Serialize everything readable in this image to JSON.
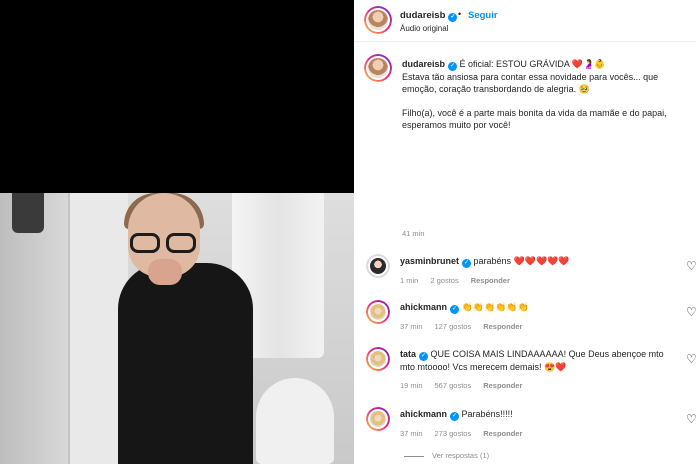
{
  "post": {
    "username": "dudareisb",
    "follow_label": "Seguir",
    "audio_label": "Áudio original",
    "caption_line1": "É oficial: ESTOU GRÁVIDA ❤️🤰👶",
    "caption_line2": "Estava tão ansiosa para contar essa novidade para vocês... que emoção, coração transbordando de alegria. 🥹",
    "caption_line3": "Filho(a), você é a parte mais bonita da vida da mamãe e do papai, esperamos muito por você!",
    "time": "41 min"
  },
  "comments": [
    {
      "user": "yasminbrunet",
      "verified": true,
      "text": "parabéns ❤️❤️❤️❤️❤️",
      "time": "1 min",
      "likes": "2 gostos",
      "reply": "Responder"
    },
    {
      "user": "ahickmann",
      "verified": true,
      "text": "👏👏👏👏👏👏",
      "time": "37 min",
      "likes": "127 gostos",
      "reply": "Responder"
    },
    {
      "user": "tata",
      "verified": true,
      "text": "QUE COISA MAIS LINDAAAAAA! Que Deus abençoe mto mto mtoooo! Vcs merecem demais! 😍❤️",
      "time": "19 min",
      "likes": "567 gostos",
      "reply": "Responder"
    },
    {
      "user": "ahickmann",
      "verified": true,
      "text": "Parabéns!!!!!",
      "time": "37 min",
      "likes": "273 gostos",
      "reply": "Responder"
    }
  ],
  "view_replies": "Ver respostas (1)",
  "colors": {
    "accent": "#0095f6",
    "heart": "#ed4956",
    "muted": "#8e8e8e"
  }
}
